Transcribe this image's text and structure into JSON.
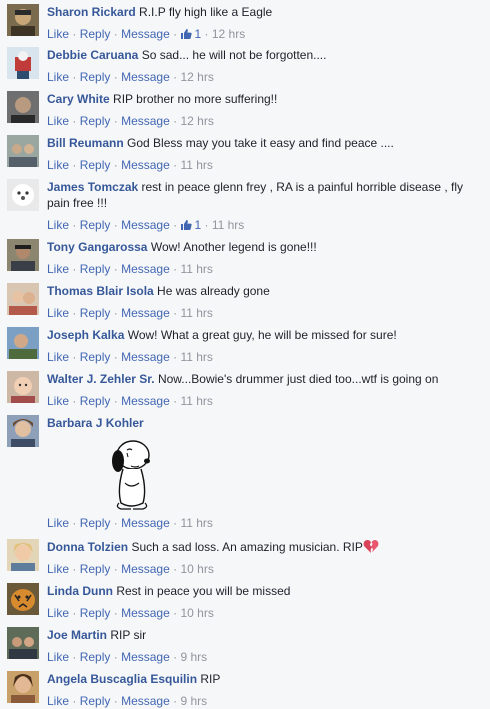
{
  "actions": {
    "like": "Like",
    "reply": "Reply",
    "message": "Message",
    "sep": "·"
  },
  "comments": [
    {
      "author": "Sharon Rickard",
      "text": "R.I.P fly high like a Eagle",
      "likes": "1",
      "time": "12 hrs"
    },
    {
      "author": "Debbie Caruana",
      "text": "So sad... he will not be forgotten....",
      "time": "12 hrs"
    },
    {
      "author": "Cary White",
      "text": "RIP brother no more suffering!!",
      "time": "12 hrs"
    },
    {
      "author": "Bill Reumann",
      "text": "God Bless may you take it easy and find peace ....",
      "time": "11 hrs"
    },
    {
      "author": "James Tomczak",
      "text": "rest in peace glenn frey , RA is a painful horrible disease , fly pain free !!!",
      "likes": "1",
      "time": "11 hrs"
    },
    {
      "author": "Tony Gangarossa",
      "text": "Wow! Another legend is gone!!!",
      "time": "11 hrs"
    },
    {
      "author": "Thomas Blair Isola",
      "text": "He was already gone",
      "time": "11 hrs"
    },
    {
      "author": "Joseph Kalka",
      "text": "Wow! What a great guy, he will be missed for sure!",
      "time": "11 hrs"
    },
    {
      "author": "Walter J. Zehler Sr.",
      "text": "Now...Bowie's drummer just died too...wtf is going on",
      "time": "11 hrs"
    },
    {
      "author": "Barbara J Kohler",
      "text": "",
      "sticker": "sad-snoopy-sticker",
      "time": "11 hrs"
    },
    {
      "author": "Donna Tolzien",
      "text": "Such a sad loss. An amazing musician. RIP",
      "emoji": "broken-heart-icon",
      "time": "10 hrs"
    },
    {
      "author": "Linda Dunn",
      "text": "Rest in peace you will be missed",
      "time": "10 hrs"
    },
    {
      "author": "Joe Martin",
      "text": "RIP sir",
      "time": "9 hrs"
    },
    {
      "author": "Angela Buscaglia Esquilin",
      "text": "RIP",
      "time": "9 hrs"
    }
  ],
  "colors": {
    "author": "#365899",
    "link": "#4267b2",
    "meta": "#90949c",
    "text": "#1d2129",
    "background": "#f6f7f9"
  }
}
